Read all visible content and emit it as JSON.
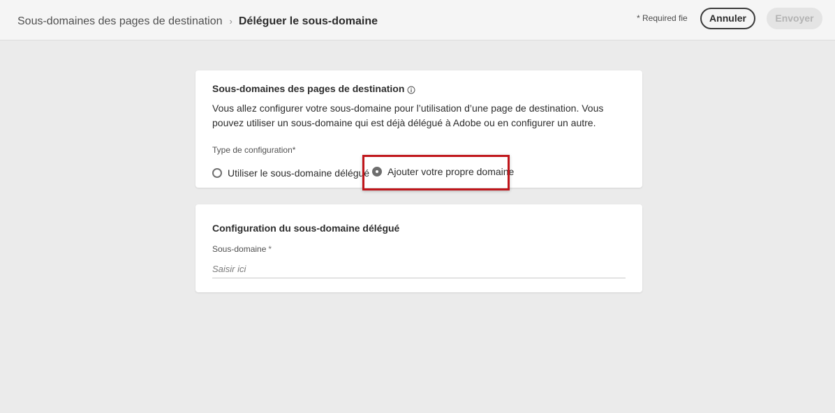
{
  "header": {
    "breadcrumb_parent": "Sous-domaines des pages de destination",
    "breadcrumb_separator": "›",
    "breadcrumb_current": "Déléguer le sous-domaine",
    "required_note": "* Required fie",
    "cancel_label": "Annuler",
    "send_label": "Envoyer"
  },
  "card_config": {
    "title": "Sous-domaines des pages de destination",
    "info_icon": "info-icon",
    "description": "Vous allez configurer votre sous-domaine pour l’utilisation d’une page de destination. Vous pouvez utiliser un sous-domaine qui est déjà délégué à Adobe ou en configurer un autre.",
    "config_type_label": "Type de configuration*",
    "options": [
      {
        "label": "Utiliser le sous-domaine délégué",
        "selected": false
      },
      {
        "label": "Ajouter votre propre domaine",
        "selected": true
      }
    ]
  },
  "card_subdomain": {
    "title": "Configuration du sous-domaine délégué",
    "field_label": "Sous-domaine",
    "required_marker": "*",
    "placeholder": "Saisir ici",
    "value": ""
  },
  "colors": {
    "highlight": "#c0161b",
    "background": "#ebebeb",
    "card": "#ffffff"
  }
}
